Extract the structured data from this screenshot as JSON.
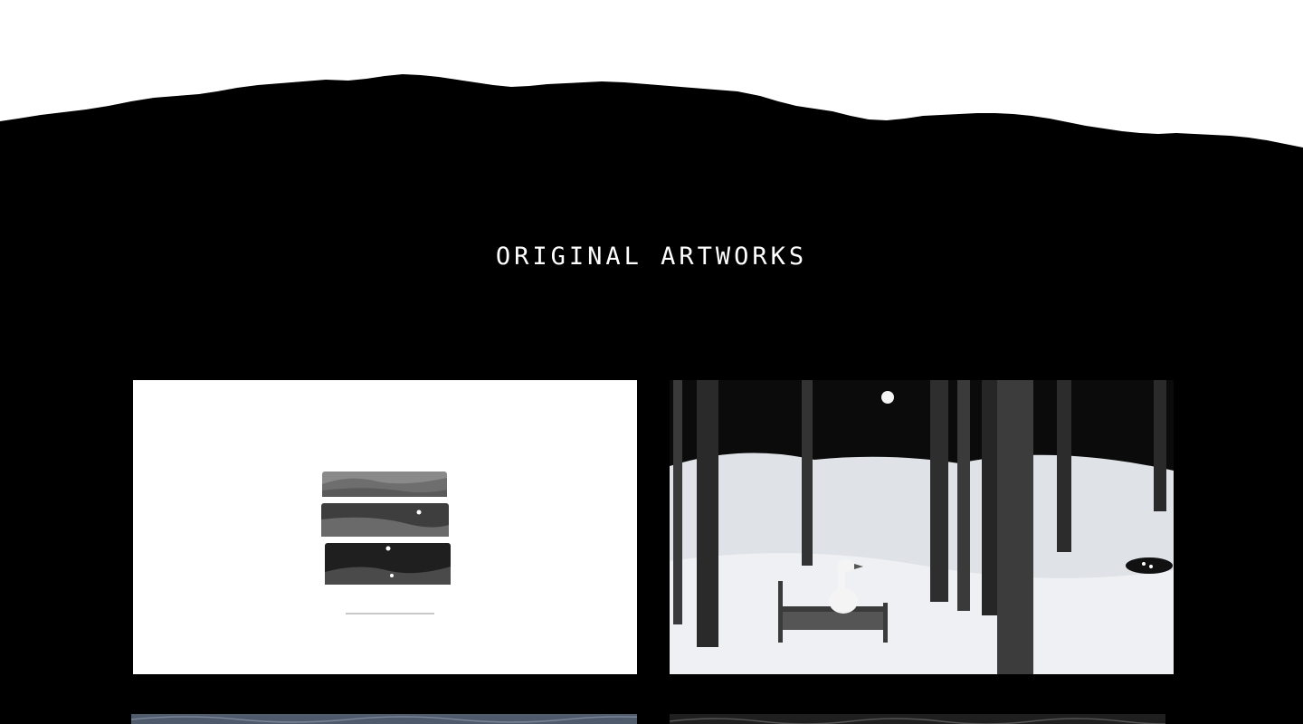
{
  "section": {
    "title": "ORIGINAL ARTWORKS"
  },
  "colors": {
    "background_top": "#ffffff",
    "background_dark": "#000000",
    "title_text": "#ffffff"
  },
  "gallery": {
    "items": [
      {
        "name": "artwork-landscape-strips"
      },
      {
        "name": "artwork-snowy-forest-goose"
      },
      {
        "name": "artwork-blue-pattern"
      },
      {
        "name": "artwork-dark-pattern"
      }
    ]
  }
}
